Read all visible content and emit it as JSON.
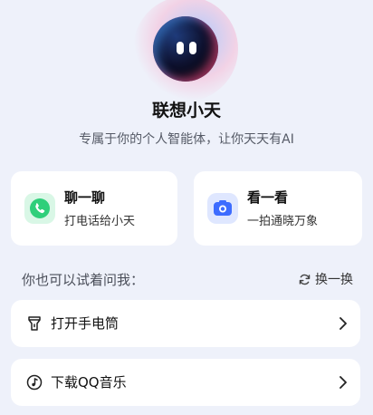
{
  "assistant": {
    "name": "联想小天",
    "tagline": "专属于你的个人智能体，让你天天有AI"
  },
  "features": [
    {
      "title": "聊一聊",
      "desc": "打电话给小天",
      "icon": "phone-icon",
      "color": "#2fcf7a"
    },
    {
      "title": "看一看",
      "desc": "一拍通晓万象",
      "icon": "camera-icon",
      "color": "#3d6cff"
    }
  ],
  "suggestions": {
    "label": "你也可以试着问我：",
    "refresh_label": "换一换",
    "items": [
      {
        "label": "打开手电筒",
        "icon": "flashlight-icon"
      },
      {
        "label": "下载QQ音乐",
        "icon": "music-note-icon"
      }
    ]
  }
}
